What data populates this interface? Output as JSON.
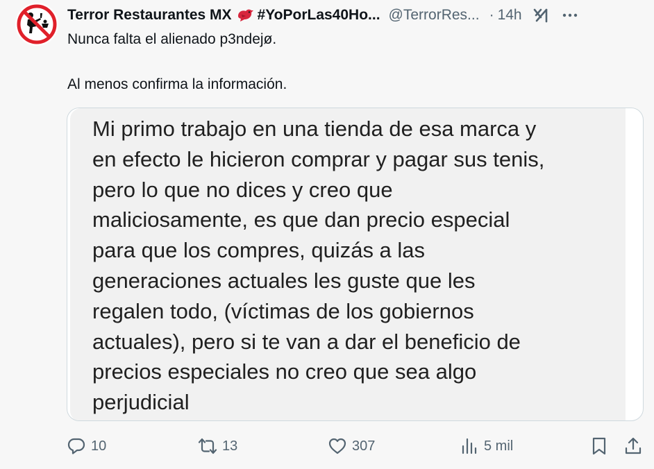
{
  "tweet": {
    "author": {
      "display_name": "Terror Restaurantes MX",
      "name_emoji": "bird-emoji",
      "hashtag": "#YoPorLas40Ho...",
      "handle": "@TerrorRes...",
      "separator": "·",
      "time": "14h",
      "avatar_icon": "no-restaurant-sign-icon"
    },
    "text_lines": [
      "Nunca falta el alienado p3ndejø.",
      "Al menos confirma la información."
    ],
    "media": {
      "lines": [
        "Mi primo trabajo en una tienda de esa marca y",
        "en efecto le hicieron comprar y pagar sus tenis,",
        "pero lo que no dices y creo que",
        "maliciosamente, es que dan precio especial",
        "para que los compres, quizás a las",
        "generaciones actuales les guste que les",
        "regalen todo, (víctimas de los gobiernos",
        "actuales), pero si te van a dar el beneficio de",
        "precios especiales no creo que sea algo",
        "perjudicial"
      ]
    },
    "actions": {
      "replies": "10",
      "retweets": "13",
      "likes": "307",
      "views": "5 mil"
    }
  },
  "colors": {
    "text_primary": "#0f1419",
    "text_secondary": "#536471",
    "background": "#f7f7f7",
    "border": "#cfd9de",
    "avatar_red": "#e0202a"
  }
}
